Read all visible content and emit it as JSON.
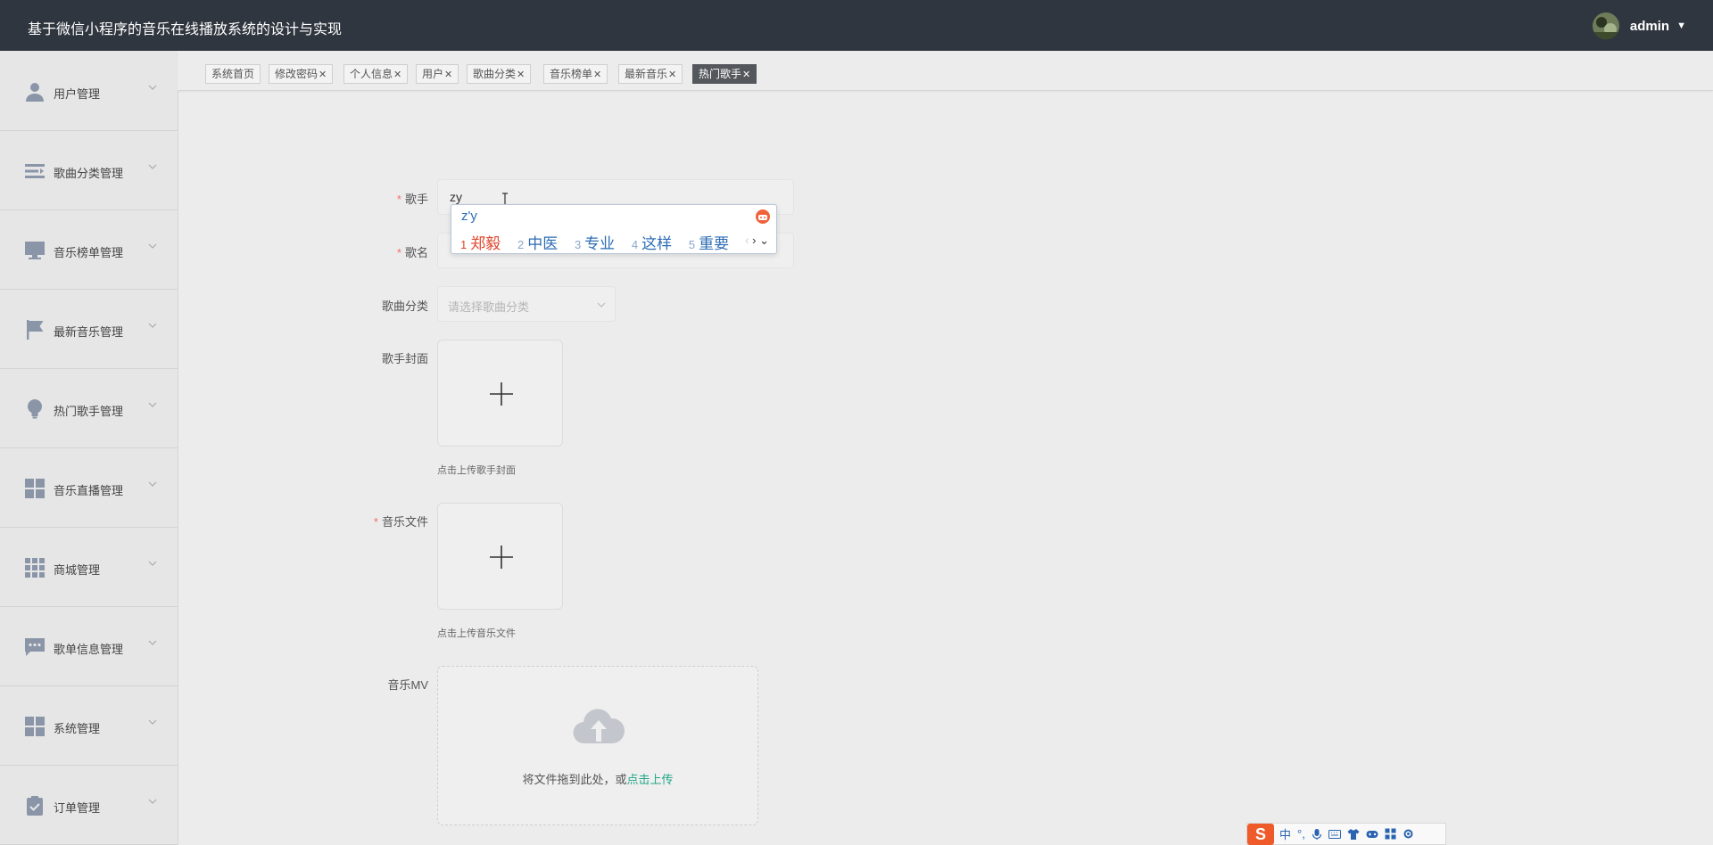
{
  "header": {
    "title": "基于微信小程序的音乐在线播放系统的设计与实现",
    "username": "admin"
  },
  "sidebar": {
    "items": [
      {
        "label": "用户管理",
        "icon": "user-icon"
      },
      {
        "label": "歌曲分类管理",
        "icon": "list-icon"
      },
      {
        "label": "音乐榜单管理",
        "icon": "monitor-icon"
      },
      {
        "label": "最新音乐管理",
        "icon": "flag-icon"
      },
      {
        "label": "热门歌手管理",
        "icon": "bulb-icon"
      },
      {
        "label": "音乐直播管理",
        "icon": "grid-icon"
      },
      {
        "label": "商城管理",
        "icon": "apps-icon"
      },
      {
        "label": "歌单信息管理",
        "icon": "chat-icon"
      },
      {
        "label": "系统管理",
        "icon": "grid-icon"
      },
      {
        "label": "订单管理",
        "icon": "clipboard-icon"
      }
    ]
  },
  "tabs": [
    {
      "label": "系统首页",
      "closable": false
    },
    {
      "label": "修改密码",
      "closable": true
    },
    {
      "label": "个人信息",
      "closable": true
    },
    {
      "label": "用户",
      "closable": true
    },
    {
      "label": "歌曲分类",
      "closable": true
    },
    {
      "label": "音乐榜单",
      "closable": true
    },
    {
      "label": "最新音乐",
      "closable": true
    },
    {
      "label": "热门歌手",
      "closable": true,
      "active": true
    }
  ],
  "form": {
    "singer": {
      "label": "歌手",
      "value": "zy",
      "required": true
    },
    "song": {
      "label": "歌名",
      "value": "",
      "required": true
    },
    "category": {
      "label": "歌曲分类",
      "placeholder": "请选择歌曲分类"
    },
    "cover": {
      "label": "歌手封面",
      "hint": "点击上传歌手封面"
    },
    "music_file": {
      "label": "音乐文件",
      "required": true,
      "hint": "点击上传音乐文件"
    },
    "mv": {
      "label": "音乐MV",
      "drag_text": "将文件拖到此处，或",
      "drag_link": "点击上传"
    }
  },
  "ime": {
    "composition": "z'y",
    "candidates": [
      {
        "num": "1",
        "text": "郑毅"
      },
      {
        "num": "2",
        "text": "中医"
      },
      {
        "num": "3",
        "text": "专业"
      },
      {
        "num": "4",
        "text": "这样"
      },
      {
        "num": "5",
        "text": "重要"
      }
    ],
    "toolbar": [
      "中",
      "°,"
    ]
  },
  "colors": {
    "topbar": "#30363f",
    "required": "#f56c6c",
    "link": "#20a587",
    "active_tab": "#54585d"
  }
}
